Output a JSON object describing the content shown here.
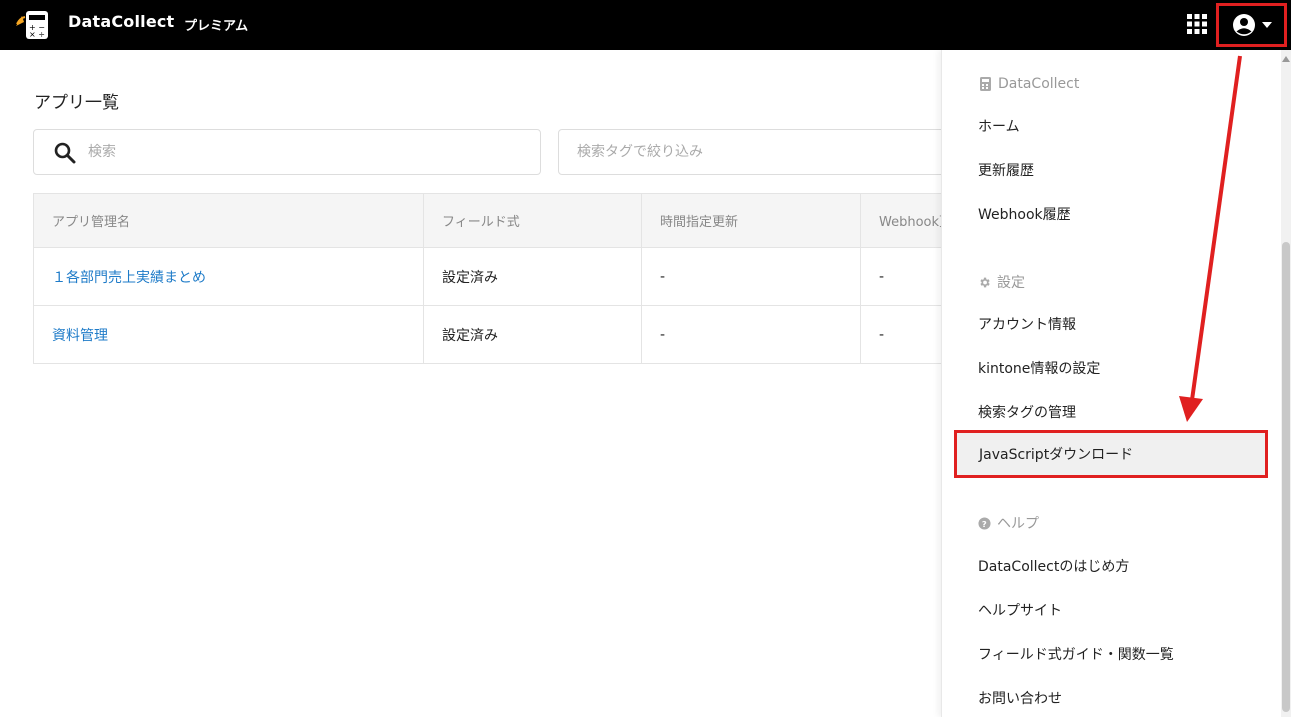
{
  "header": {
    "brand": "DataCollect",
    "plan": "プレミアム",
    "logo_icon": "calculator-logo",
    "apps_icon": "grid-icon",
    "user_icon": "account-circle-icon",
    "highlight_color": "#e02020"
  },
  "main": {
    "title": "アプリ一覧",
    "search": {
      "placeholder": "検索"
    },
    "tag_filter": {
      "placeholder": "検索タグで絞り込み"
    },
    "table": {
      "headers": [
        "アプリ管理名",
        "フィールド式",
        "時間指定更新",
        "Webhook更新"
      ],
      "rows": [
        [
          "１各部門売上実績まとめ",
          "設定済み",
          "-",
          "-"
        ],
        [
          "資料管理",
          "設定済み",
          "-",
          "-"
        ]
      ]
    }
  },
  "menu": {
    "section_datacollect": {
      "label": "DataCollect",
      "icon": "calculator-icon"
    },
    "home": "ホーム",
    "history": "更新履歴",
    "webhook_history": "Webhook履歴",
    "section_settings": {
      "label": "設定",
      "icon": "gear-icon"
    },
    "account": "アカウント情報",
    "kintone": "kintone情報の設定",
    "tags": "検索タグの管理",
    "js_download": "JavaScriptダウンロード",
    "section_help": {
      "label": "ヘルプ",
      "icon": "help-circle-icon"
    },
    "getting_started": "DataCollectのはじめ方",
    "help_site": "ヘルプサイト",
    "field_guide": "フィールド式ガイド・関数一覧",
    "contact": "お問い合わせ"
  }
}
